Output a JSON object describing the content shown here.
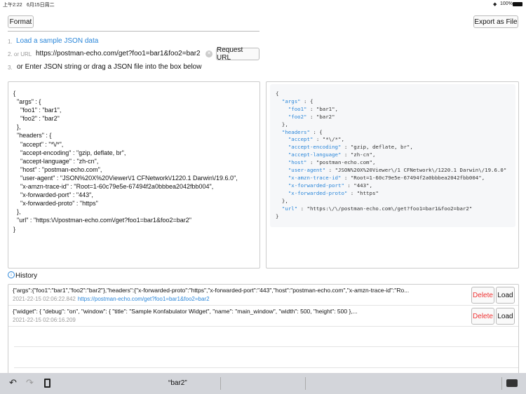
{
  "status_bar": {
    "time": "上午2:22",
    "date": "6月15日周二",
    "battery": "100%"
  },
  "toolbar": {
    "format_label": "Format",
    "export_label": "Export as File"
  },
  "steps": {
    "step1_num": "1.",
    "step1_link": "Load a sample JSON data",
    "step2_num": "2. or URL",
    "url_value": "https://postman-echo.com/get?foo1=bar1&foo2=bar2",
    "request_label": "Request URL",
    "step3_num": "3.",
    "step3_text": "or Enter JSON string or drag a JSON file into the box below"
  },
  "editor": {
    "text": "{\n  \"args\" : {\n    \"foo1\" : \"bar1\",\n    \"foo2\" : \"bar2\"\n  },\n  \"headers\" : {\n    \"accept\" : \"*\\/*\",\n    \"accept-encoding\" : \"gzip, deflate, br\",\n    \"accept-language\" : \"zh-cn\",\n    \"host\" : \"postman-echo.com\",\n    \"user-agent\" : \"JSON%20X%20Viewer\\/1 CFNetwork\\/1220.1 Darwin\\/19.6.0\",\n    \"x-amzn-trace-id\" : \"Root=1-60c79e5e-67494f2a0bbbea2042fbb004\",\n    \"x-forwarded-port\" : \"443\",\n    \"x-forwarded-proto\" : \"https\"\n  },\n  \"url\" : \"https:\\/\\/postman-echo.com\\/get?foo1=bar1&foo2=bar2\"\n}"
  },
  "viewer": {
    "lines": [
      [
        "{",
        ""
      ],
      [
        "  ",
        "\"args\"",
        ": {"
      ],
      [
        "    ",
        "\"foo1\"",
        ": \"bar1\","
      ],
      [
        "    ",
        "\"foo2\"",
        ": \"bar2\""
      ],
      [
        "  },",
        ""
      ],
      [
        "  ",
        "\"headers\"",
        ": {"
      ],
      [
        "    ",
        "\"accept\"",
        ": \"*\\/*\","
      ],
      [
        "    ",
        "\"accept-encoding\"",
        ": \"gzip, deflate, br\","
      ],
      [
        "    ",
        "\"accept-language\"",
        ": \"zh-cn\","
      ],
      [
        "    ",
        "\"host\"",
        ": \"postman-echo.com\","
      ],
      [
        "    ",
        "\"user-agent\"",
        ": \"JSON%20X%20Viewer\\/1 CFNetwork\\/1220.1 Darwin\\/19.6.0\""
      ],
      [
        "    ",
        "\"x-amzn-trace-id\"",
        ": \"Root=1-60c79e5e-67494f2a0bbbea2042fbb004\","
      ],
      [
        "    ",
        "\"x-forwarded-port\"",
        ": \"443\","
      ],
      [
        "    ",
        "\"x-forwarded-proto\"",
        ": \"https\""
      ],
      [
        "  },",
        ""
      ],
      [
        "  ",
        "\"url\"",
        ": \"https:\\/\\/postman-echo.com\\/get?foo1=bar1&foo2=bar2\""
      ],
      [
        "}",
        ""
      ]
    ],
    "key_color": "#2a86d9"
  },
  "history": {
    "title": "History",
    "delete_label": "Delete",
    "load_label": "Load",
    "items": [
      {
        "text": "{\"args\":{\"foo1\":\"bar1\",\"foo2\":\"bar2\"},\"headers\":{\"x-forwarded-proto\":\"https\",\"x-forwarded-port\":\"443\",\"host\":\"postman-echo.com\",\"x-amzn-trace-id\":\"Ro...",
        "time": "2021-22-15 02:06:22.842",
        "url": "https://postman-echo.com/get?foo1=bar1&foo2=bar2"
      },
      {
        "text": "{\"widget\": {    \"debug\": \"on\",    \"window\": {        \"title\": \"Sample Konfabulator Widget\",        \"name\": \"main_window\",        \"width\": 500,        \"height\": 500    },...",
        "time": "2021-22-15 02:06:16.209"
      }
    ]
  },
  "keyboard_bar": {
    "suggestion": "“bar2”"
  }
}
